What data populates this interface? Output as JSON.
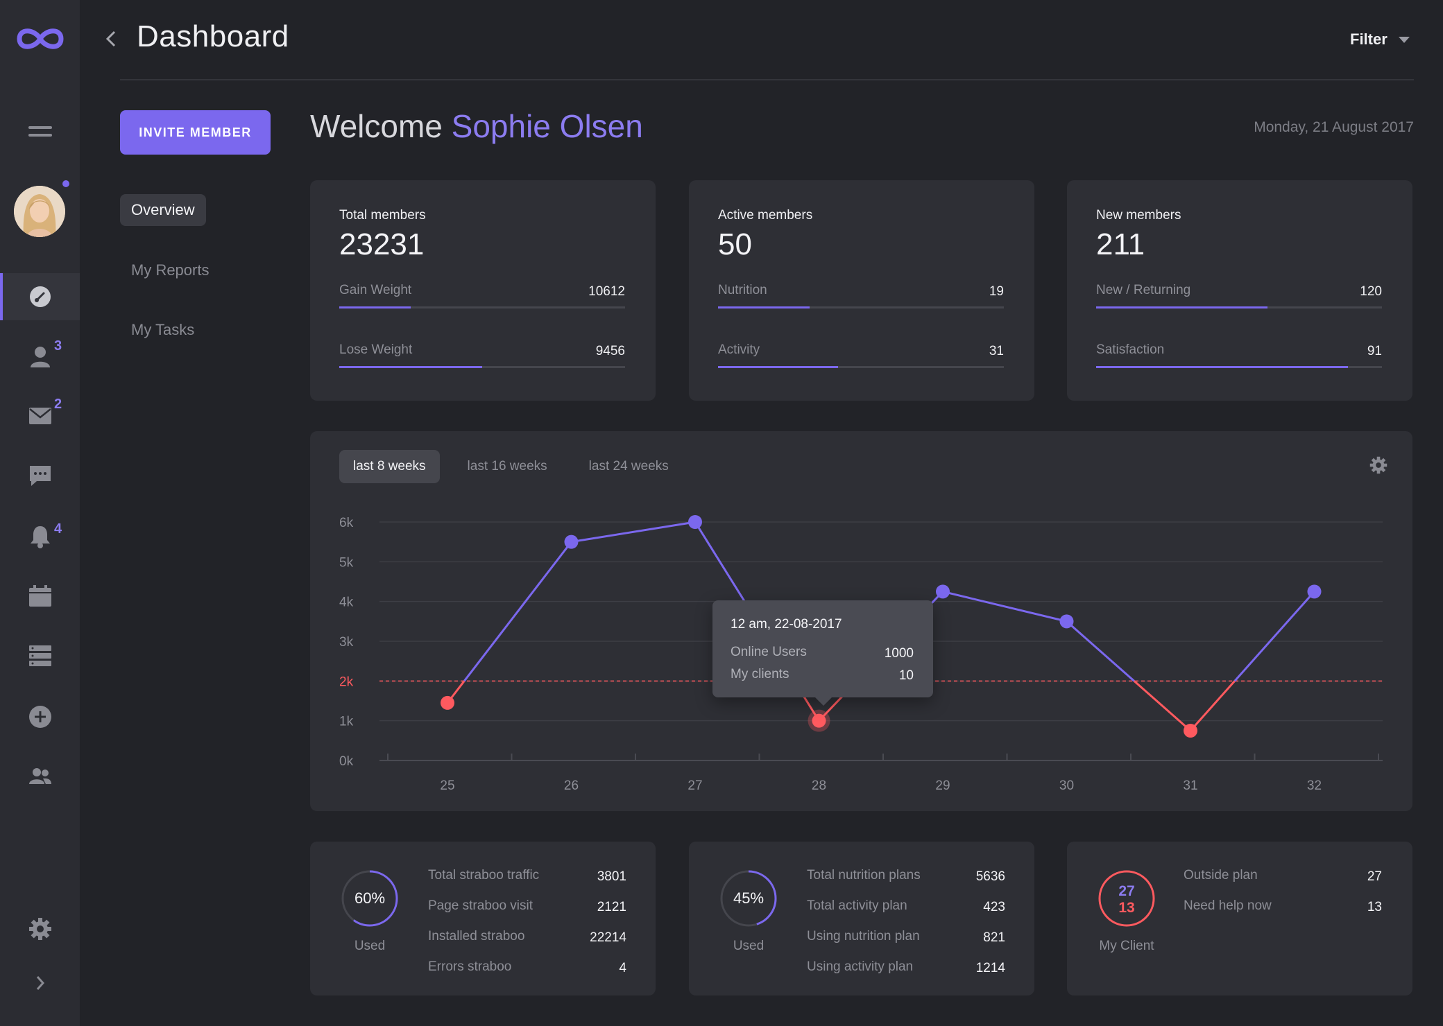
{
  "header": {
    "title": "Dashboard",
    "filter_label": "Filter"
  },
  "sidebar": {
    "badges": {
      "users": "3",
      "mail": "2",
      "notifications": "4"
    }
  },
  "subnav": {
    "invite_label": "INVITE MEMBER",
    "items": [
      {
        "label": "Overview",
        "active": true
      },
      {
        "label": "My Reports",
        "active": false
      },
      {
        "label": "My Tasks",
        "active": false
      }
    ]
  },
  "welcome": {
    "prefix": "Welcome",
    "name": "Sophie Olsen",
    "date": "Monday, 21 August 2017"
  },
  "stats": [
    {
      "title": "Total members",
      "value": "23231",
      "metrics": [
        {
          "label": "Gain Weight",
          "value": "10612",
          "fill": 0.25
        },
        {
          "label": "Lose Weight",
          "value": "9456",
          "fill": 0.5
        }
      ]
    },
    {
      "title": "Active members",
      "value": "50",
      "metrics": [
        {
          "label": "Nutrition",
          "value": "19",
          "fill": 0.32
        },
        {
          "label": "Activity",
          "value": "31",
          "fill": 0.42
        }
      ]
    },
    {
      "title": "New members",
      "value": "211",
      "metrics": [
        {
          "label": "New / Returning",
          "value": "120",
          "fill": 0.6
        },
        {
          "label": "Satisfaction",
          "value": "91",
          "fill": 0.88
        }
      ]
    }
  ],
  "chart_tabs": [
    "last 8 weeks",
    "last 16 weeks",
    "last 24 weeks"
  ],
  "chart_data": {
    "type": "line",
    "categories": [
      "25",
      "26",
      "27",
      "28",
      "29",
      "30",
      "31",
      "32"
    ],
    "values": [
      1450,
      5500,
      6000,
      1000,
      4250,
      3500,
      750,
      4250
    ],
    "ylim": [
      0,
      6000
    ],
    "yticks": [
      "0k",
      "1k",
      "2k",
      "3k",
      "4k",
      "5k",
      "6k"
    ],
    "threshold": {
      "value": 2000,
      "label": "2k"
    },
    "colors": {
      "above": "#7b68ee",
      "below": "#ff5a5f",
      "threshold": "#ff5a5f"
    },
    "grid": true
  },
  "tooltip": {
    "title": "12 am, 22-08-2017",
    "rows": [
      {
        "label": "Online Users",
        "value": "1000"
      },
      {
        "label": "My clients",
        "value": "10"
      }
    ]
  },
  "bottom": [
    {
      "ring_label": "60%",
      "ring_fill": 0.6,
      "sub": "Used",
      "items": [
        {
          "label": "Total straboo traffic",
          "value": "3801"
        },
        {
          "label": "Page straboo visit",
          "value": "2121"
        },
        {
          "label": "Installed straboo",
          "value": "22214"
        },
        {
          "label": "Errors straboo",
          "value": "4"
        }
      ]
    },
    {
      "ring_label": "45%",
      "ring_fill": 0.45,
      "sub": "Used",
      "items": [
        {
          "label": "Total nutrition plans",
          "value": "5636"
        },
        {
          "label": "Total activity plan",
          "value": "423"
        },
        {
          "label": "Using nutrition plan",
          "value": "821"
        },
        {
          "label": "Using activity plan",
          "value": "1214"
        }
      ]
    },
    {
      "ring_a": "27",
      "ring_b": "13",
      "sub": "My Client",
      "items": [
        {
          "label": "Outside plan",
          "value": "27"
        },
        {
          "label": "Need help now",
          "value": "13"
        }
      ]
    }
  ],
  "colors": {
    "accent": "#7b68ee",
    "alert": "#ff5a5f",
    "background": "#222328",
    "card": "#2e2f35"
  }
}
